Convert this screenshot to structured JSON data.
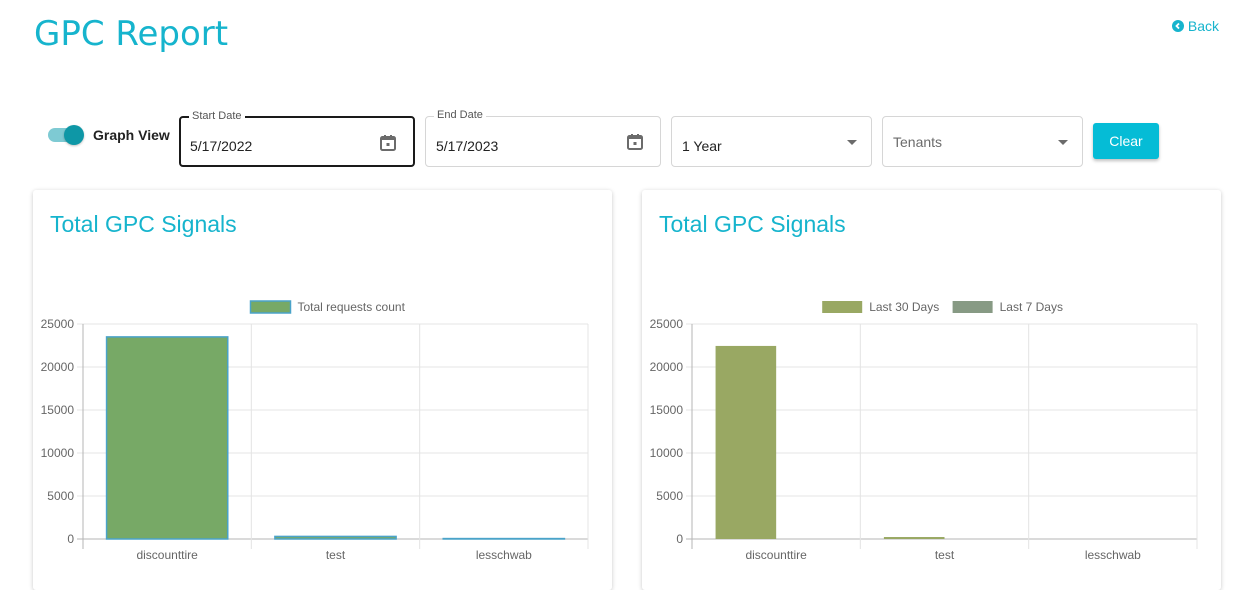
{
  "header": {
    "title": "GPC Report",
    "back_label": "Back"
  },
  "filters": {
    "graph_view_label": "Graph View",
    "graph_view_on": true,
    "start_date_label": "Start Date",
    "start_date_value": "5/17/2022",
    "end_date_label": "End Date",
    "end_date_value": "5/17/2023",
    "range_value": "1 Year",
    "tenants_placeholder": "Tenants",
    "clear_label": "Clear"
  },
  "colors": {
    "accent": "#16b4cd",
    "button": "#05bcd6",
    "total_bar": "#77a966",
    "total_bar_border": "#4aa3c9",
    "last30": "#99a863",
    "last7": "#879a84"
  },
  "cards": [
    {
      "title": "Total GPC Signals"
    },
    {
      "title": "Total GPC Signals"
    }
  ],
  "chart_data": [
    {
      "type": "bar",
      "title": "Total GPC Signals",
      "categories": [
        "discounttire",
        "test",
        "lesschwab"
      ],
      "series": [
        {
          "name": "Total requests count",
          "values": [
            23500,
            300,
            50
          ]
        }
      ],
      "ylim": [
        0,
        25000
      ],
      "yticks": [
        0,
        5000,
        10000,
        15000,
        20000,
        25000
      ],
      "xlabel": "",
      "ylabel": "",
      "grid": true,
      "legend": "top"
    },
    {
      "type": "bar",
      "title": "Total GPC Signals",
      "categories": [
        "discounttire",
        "test",
        "lesschwab"
      ],
      "series": [
        {
          "name": "Last 30 Days",
          "values": [
            22450,
            230,
            0
          ]
        },
        {
          "name": "Last 7 Days",
          "values": [
            0,
            0,
            0
          ]
        }
      ],
      "ylim": [
        0,
        25000
      ],
      "yticks": [
        0,
        5000,
        10000,
        15000,
        20000,
        25000
      ],
      "xlabel": "",
      "ylabel": "",
      "grid": true,
      "legend": "top"
    }
  ]
}
